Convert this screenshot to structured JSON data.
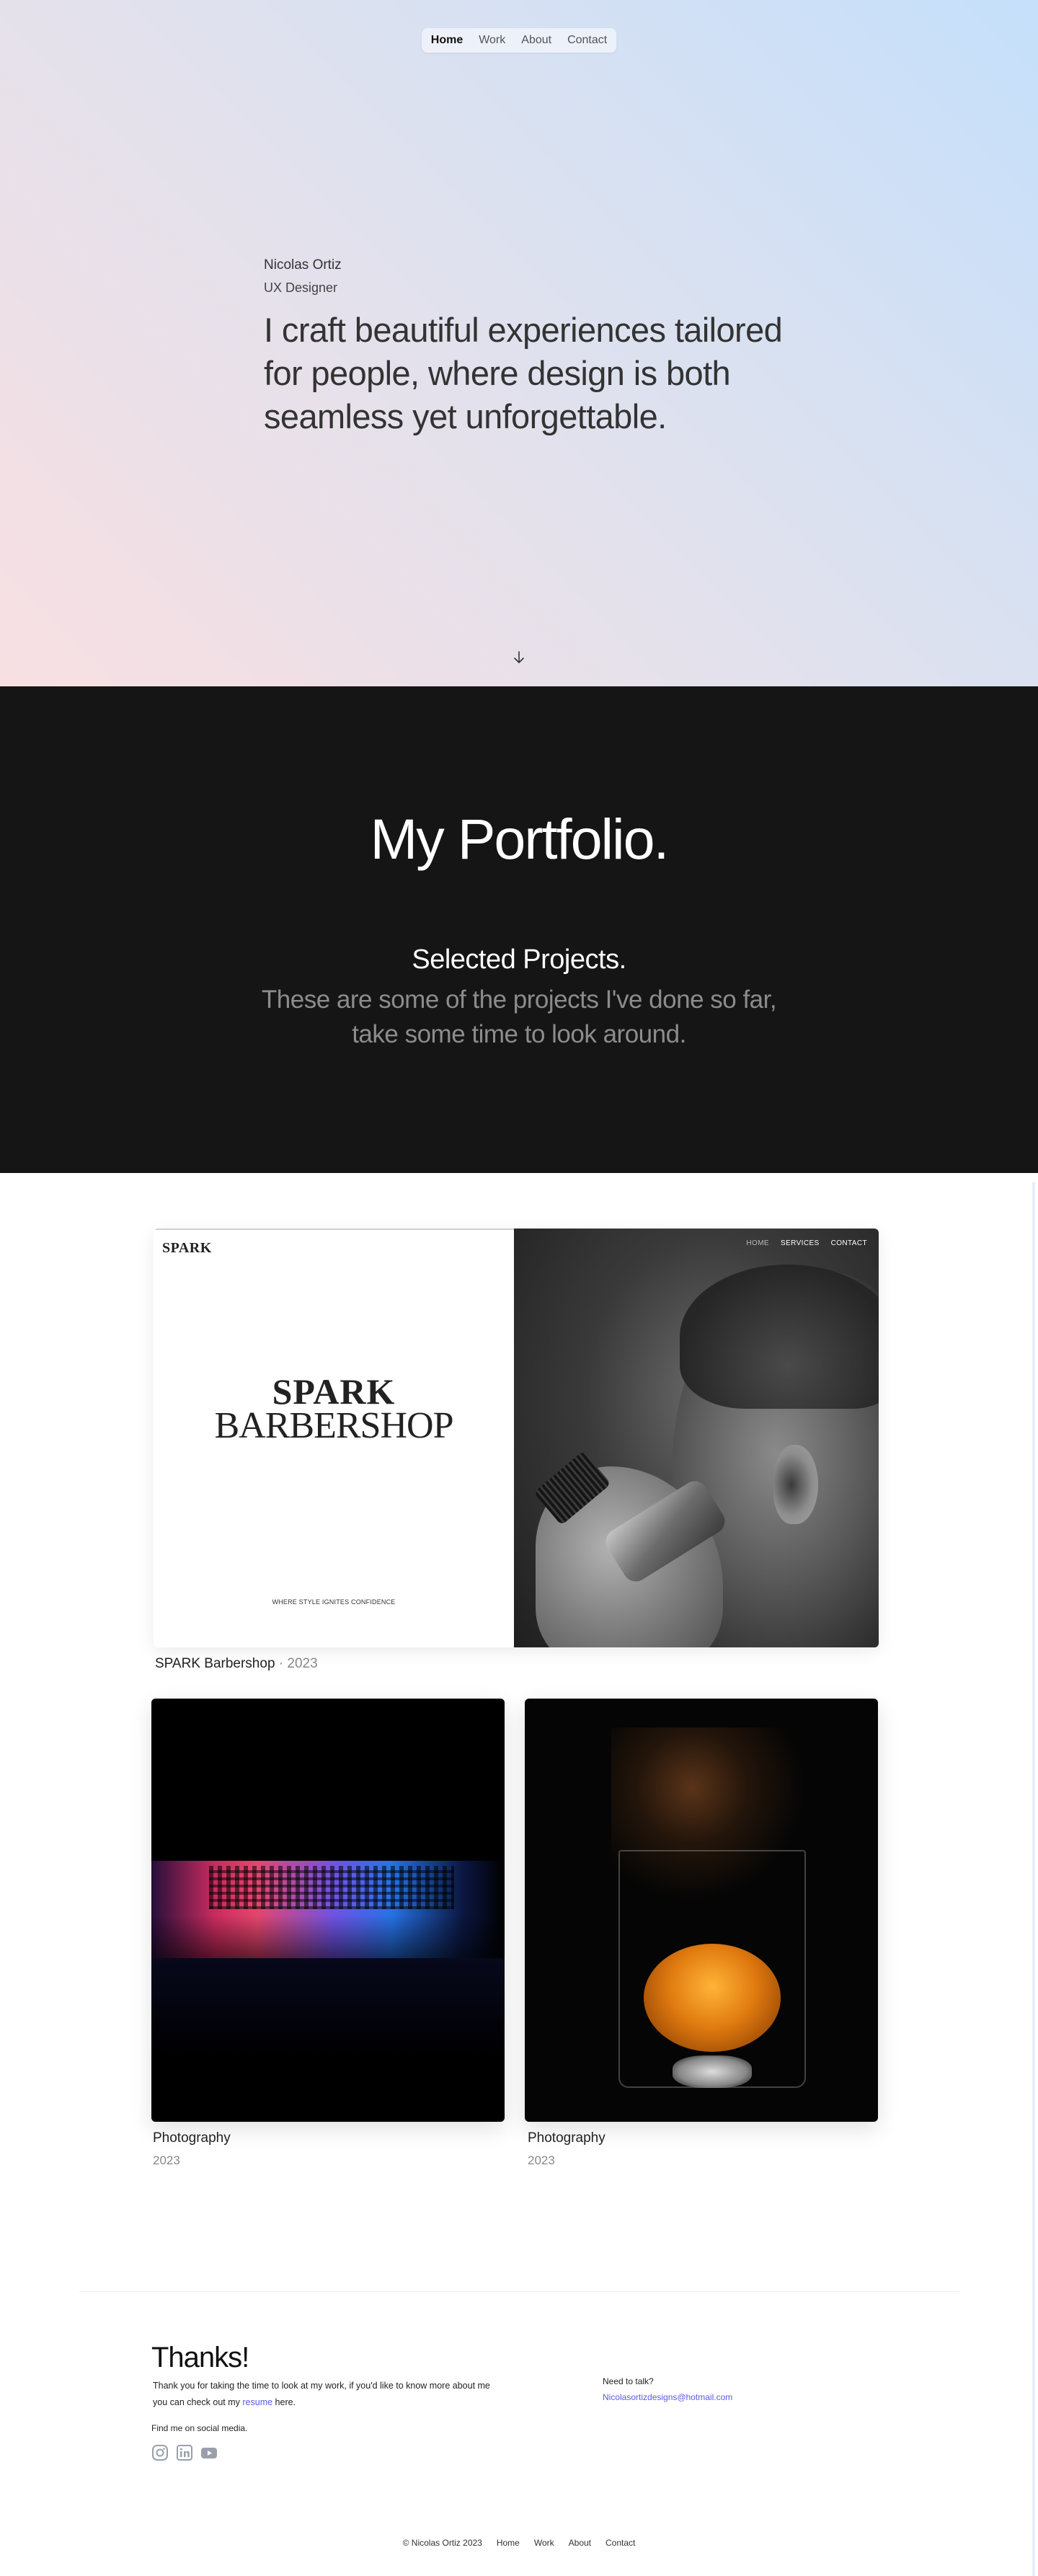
{
  "nav": {
    "items": [
      {
        "label": "Home",
        "active": true
      },
      {
        "label": "Work"
      },
      {
        "label": "About"
      },
      {
        "label": "Contact"
      }
    ]
  },
  "hero": {
    "name": "Nicolas Ortiz",
    "role": "UX Designer",
    "tagline": "I craft beautiful experiences tailored for people, where design is both seamless yet unforgettable.",
    "scroll_icon": "arrow-down-icon"
  },
  "portfolio": {
    "heading": "My Portfolio.",
    "subheading": "Selected Projects.",
    "description": "These are some of the projects I've done so far, take some time to look around."
  },
  "featured": {
    "logo": "SPARK",
    "title_line1": "SPARK",
    "title_line2": "BARBERSHOP",
    "tagline": "WHERE STYLE IGNITES CONFIDENCE",
    "menu": [
      "HOME",
      "SERVICES",
      "CONTACT"
    ],
    "caption_name": "SPARK Barbershop",
    "caption_year": "· 2023"
  },
  "cards": [
    {
      "title": "Photography",
      "year": "2023"
    },
    {
      "title": "Photography",
      "year": "2023"
    }
  ],
  "footer": {
    "thanks": "Thanks!",
    "message_before": "Thank you for taking the time to look at my work, if you'd like to know more about me you can check out my ",
    "resume_link": "resume",
    "message_after": " here.",
    "social_label": "Find me on social media.",
    "socials": [
      "instagram-icon",
      "linkedin-icon",
      "youtube-icon"
    ],
    "talk_label": "Need to talk?",
    "email": "Nicolasortizdesigns@hotmail.com",
    "copyright": "© Nicolas Ortiz 2023",
    "links": [
      "Home",
      "Work",
      "About",
      "Contact"
    ]
  },
  "colors": {
    "accent": "#5b5be8",
    "dark_bg": "#151515",
    "hero_gradient_start": "#c5e0fb",
    "hero_gradient_end": "#f8e0e2"
  }
}
